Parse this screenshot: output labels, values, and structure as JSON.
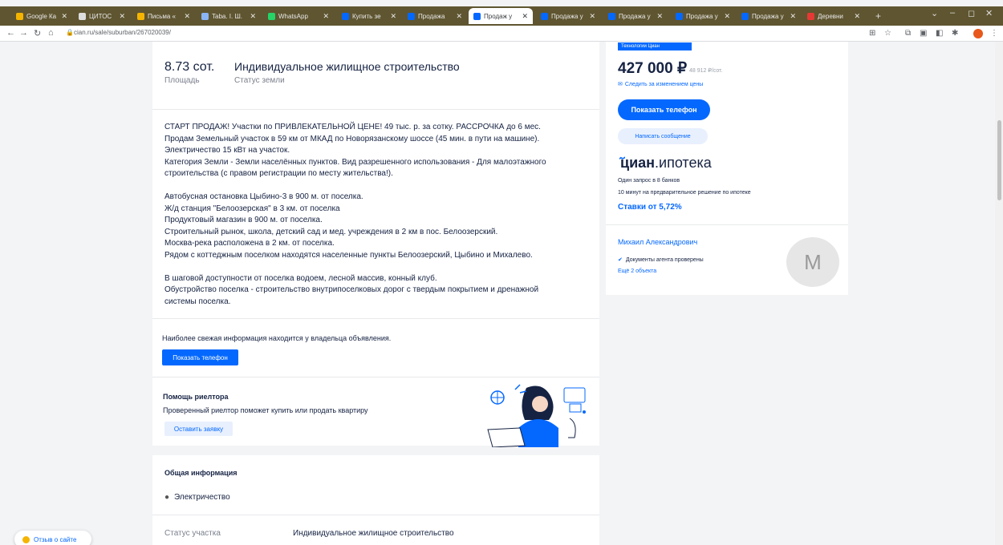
{
  "browser": {
    "tabs": [
      {
        "label": "Google Ка",
        "color": "#f4b400"
      },
      {
        "label": "ЦИТОС",
        "color": "#dddddd"
      },
      {
        "label": "Письма «",
        "color": "#f4b400"
      },
      {
        "label": "Taba. I. Ш.",
        "color": "#8ab4f8"
      },
      {
        "label": "WhatsApp",
        "color": "#25d366"
      },
      {
        "label": "Купить зе",
        "color": "#0468ff"
      },
      {
        "label": "Продажа",
        "color": "#0468ff"
      },
      {
        "label": "Продаж у",
        "color": "#0468ff",
        "active": true
      },
      {
        "label": "Продажа у",
        "color": "#0468ff"
      },
      {
        "label": "Продажа у",
        "color": "#0468ff"
      },
      {
        "label": "Продажа у",
        "color": "#0468ff"
      },
      {
        "label": "Продажа у",
        "color": "#0468ff"
      },
      {
        "label": "Деревни",
        "color": "#e53935"
      }
    ],
    "new_tab": "+",
    "url": "cian.ru/sale/suburban/267020039/",
    "window_controls": [
      "⌄",
      "–",
      "◻",
      "✕"
    ]
  },
  "listing": {
    "area_value": "8.73 сот.",
    "area_label": "Площадь",
    "land_status_value": "Индивидуальное жилищное строительство",
    "land_status_label": "Статус земли",
    "description": [
      "СТАРТ ПРОДАЖ! Участки по ПРИВЛЕКАТЕЛЬНОЙ ЦЕНЕ! 49 тыс. р. за сотку. РАССРОЧКА до 6 мес.",
      "Продам Земельный участок в 59 км от МКАД по Новорязанскому шоссе (45 мин. в пути на машине).",
      "Электричество 15 кВт на участок.",
      "Категория Земли - Земли населённых пунктов. Вид разрешенного использования - Для малоэтажного",
      "строительства (с правом регистрации по месту жительства!).",
      "",
      "Автобусная остановка Цыбино-3 в 900 м. от поселка.",
      "Ж/д станция \"Белоозерская\" в 3 км. от поселка",
      "Продуктовый магазин в 900 м. от поселка.",
      "Строительный рынок, школа, детский сад и мед. учреждения в 2 км в пос. Белоозерский.",
      "Москва-река расположена в 2 км. от поселка.",
      "Рядом с коттеджным поселком находятся населенные пункты Белоозерский, Цыбино и Михалево.",
      "",
      "В шаговой доступности от поселка водоем, лесной массив, конный клуб.",
      "Обустройство поселка - строительство внутрипоселковых дорог с твердым покрытием и дренажной",
      "системы поселка."
    ],
    "owner_info": "Наиболее свежая информация находится у владельца объявления.",
    "show_phone": "Показать телефон",
    "realtor_title": "Помощь риелтора",
    "realtor_text": "Проверенный риелтор поможет купить или продать квартиру",
    "realtor_button": "Оставить заявку",
    "general_title": "Общая информация",
    "electricity": "Электричество",
    "plot_status_label": "Статус участка",
    "plot_status_value": "Индивидуальное жилищное строительство"
  },
  "sidebar": {
    "badge": "Технологии Циан",
    "price": "427 000 ₽",
    "price_per_unit": "48 912 ₽/сот.",
    "track_price": "Следить за изменением цены",
    "show_phone": "Показать телефон",
    "write_message": "Написать сообщение",
    "mortgage_brand": "циан",
    "mortgage_brand_suffix": ".ипотека",
    "mortgage_line1": "Один запрос в 8 банков",
    "mortgage_line2": "10 минут на предварительное решение по ипотеке",
    "mortgage_rates": "Ставки от 5,72%",
    "agent_name": "Михаил Александрович",
    "agent_verified": "Документы агента проверены",
    "agent_more": "Ещё 2 объекта",
    "avatar_letter": "М"
  },
  "feedback": "Отзыв о сайте",
  "colors": {
    "accent": "#0468ff",
    "text": "#152242",
    "muted": "#7a7f8c"
  }
}
